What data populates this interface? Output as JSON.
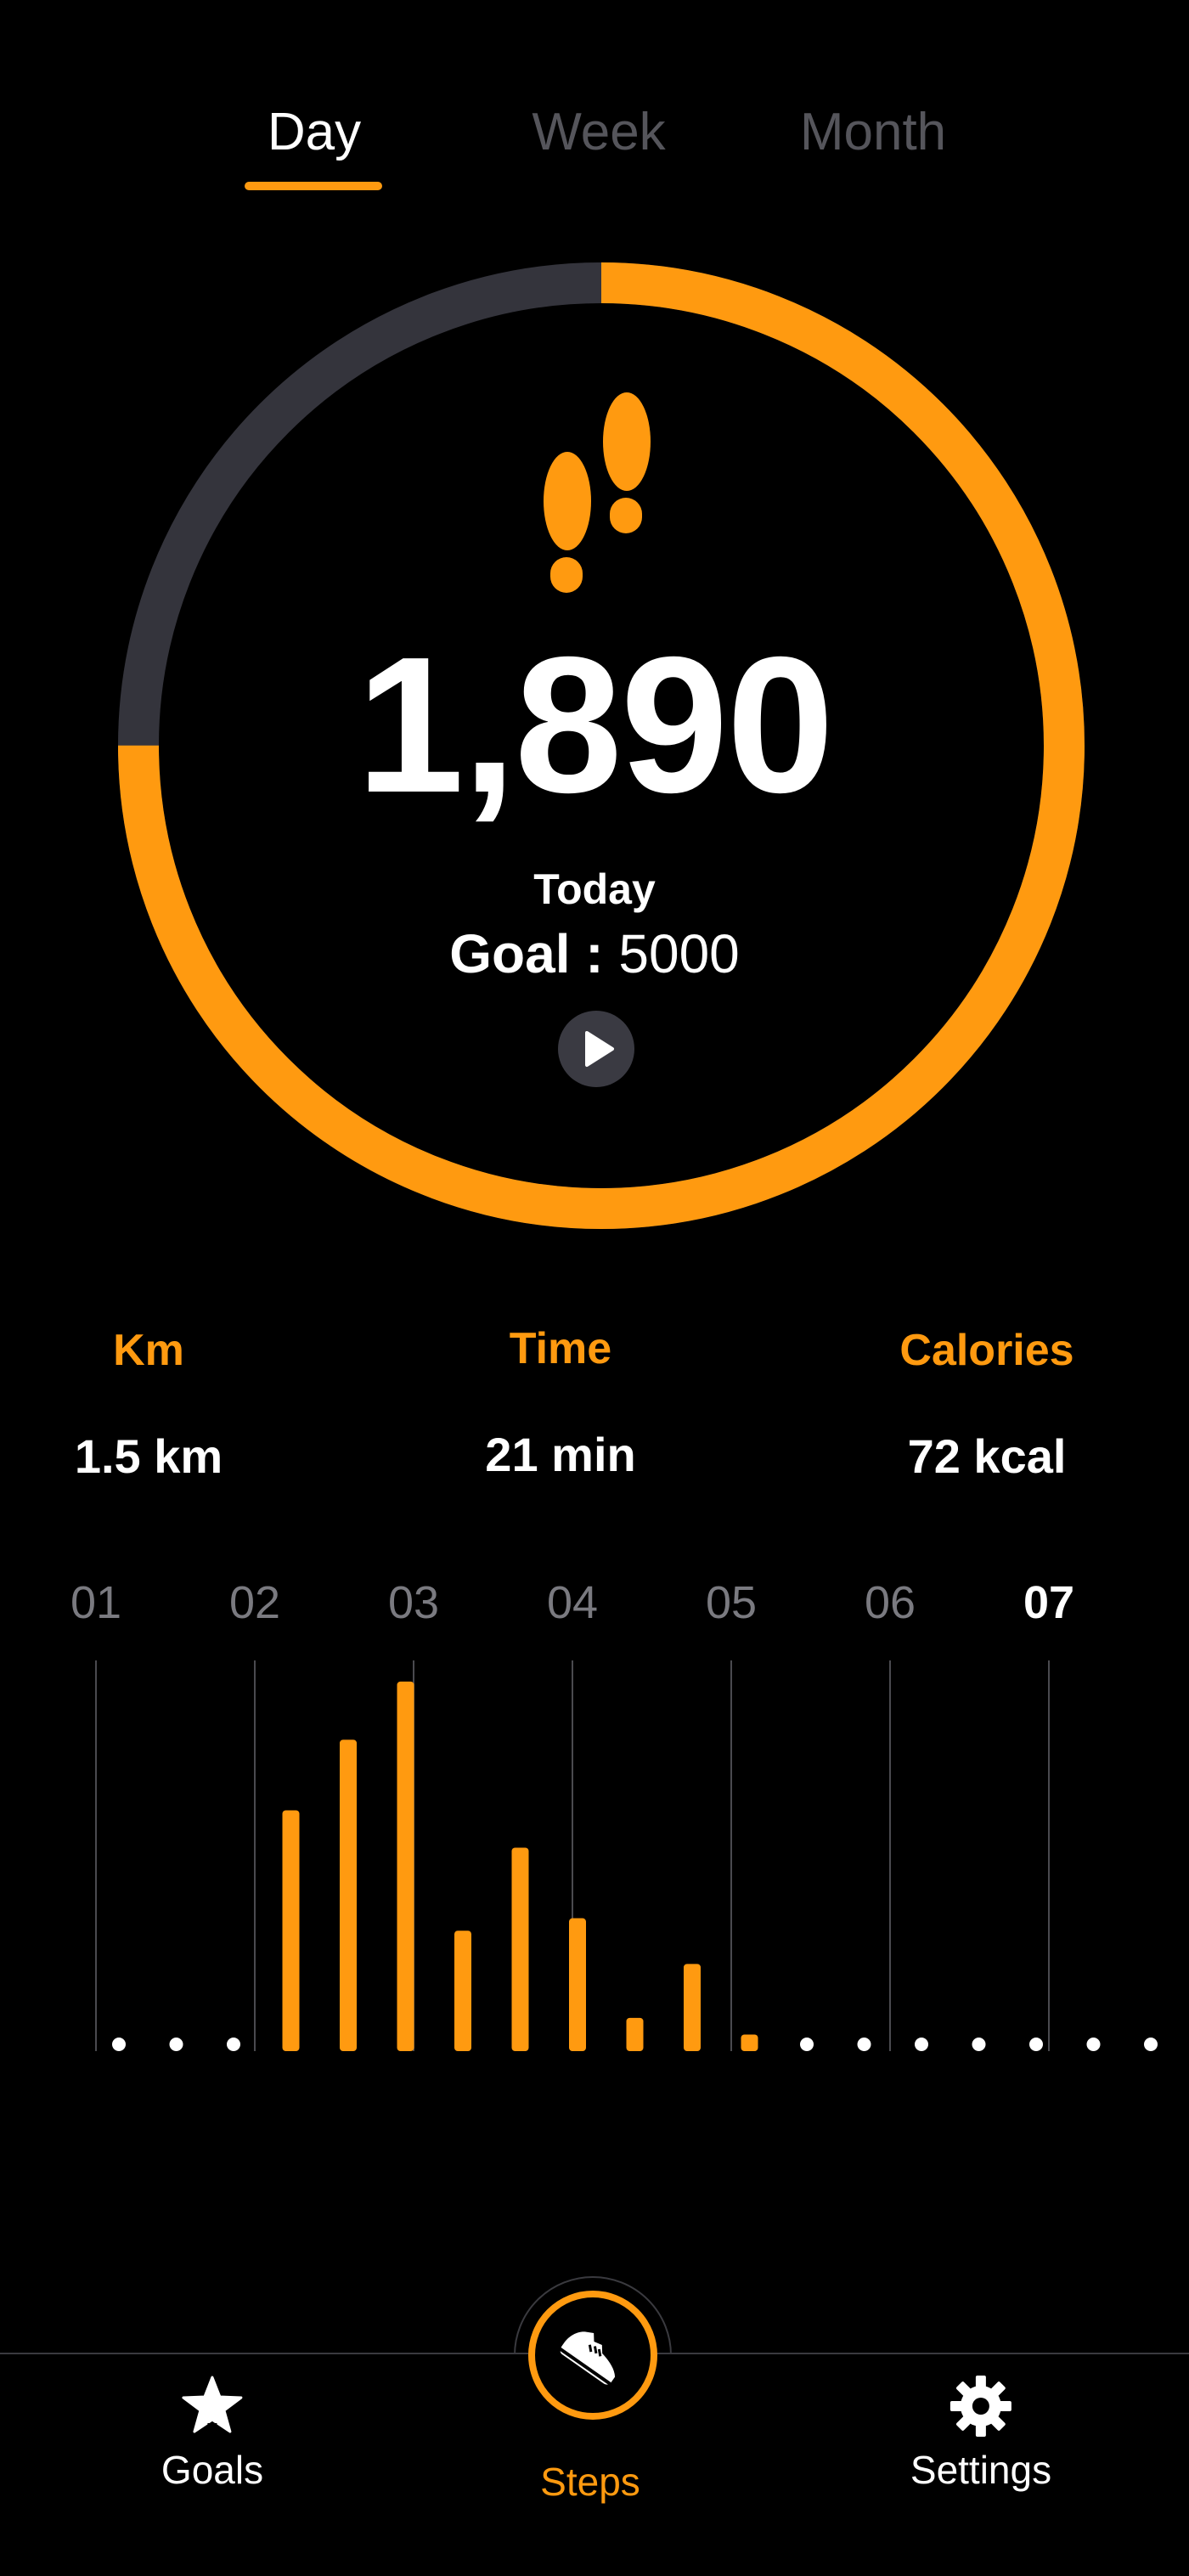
{
  "tabs": [
    {
      "label": "Day",
      "active": true
    },
    {
      "label": "Week",
      "active": false
    },
    {
      "label": "Month",
      "active": false
    }
  ],
  "summary": {
    "steps": "1,890",
    "period_label": "Today",
    "goal_label": "Goal :",
    "goal_value": "5000",
    "progress_fraction": 0.75
  },
  "stats": {
    "km": {
      "label": "Km",
      "value": "1.5 km"
    },
    "time": {
      "label": "Time",
      "value": "21 min"
    },
    "calories": {
      "label": "Calories",
      "value": "72 kcal"
    }
  },
  "chart_data": {
    "type": "bar",
    "x_tick_labels": [
      "01",
      "02",
      "03",
      "04",
      "05",
      "06",
      "07"
    ],
    "highlighted_tick": "07",
    "values": [
      0,
      0,
      0,
      290,
      375,
      445,
      145,
      245,
      160,
      40,
      105,
      20,
      0,
      0,
      0,
      0,
      0,
      0,
      0,
      0,
      0
    ],
    "ylim": [
      0,
      450
    ],
    "grid": true
  },
  "bottom_nav": {
    "goals": {
      "label": "Goals",
      "icon": "star-icon"
    },
    "steps": {
      "label": "Steps",
      "icon": "sneaker-icon",
      "active": true
    },
    "settings": {
      "label": "Settings",
      "icon": "gear-icon"
    }
  },
  "colors": {
    "accent": "#ff9a10",
    "track": "#34343c",
    "background": "#000000",
    "inactive_tab": "#55555b"
  }
}
